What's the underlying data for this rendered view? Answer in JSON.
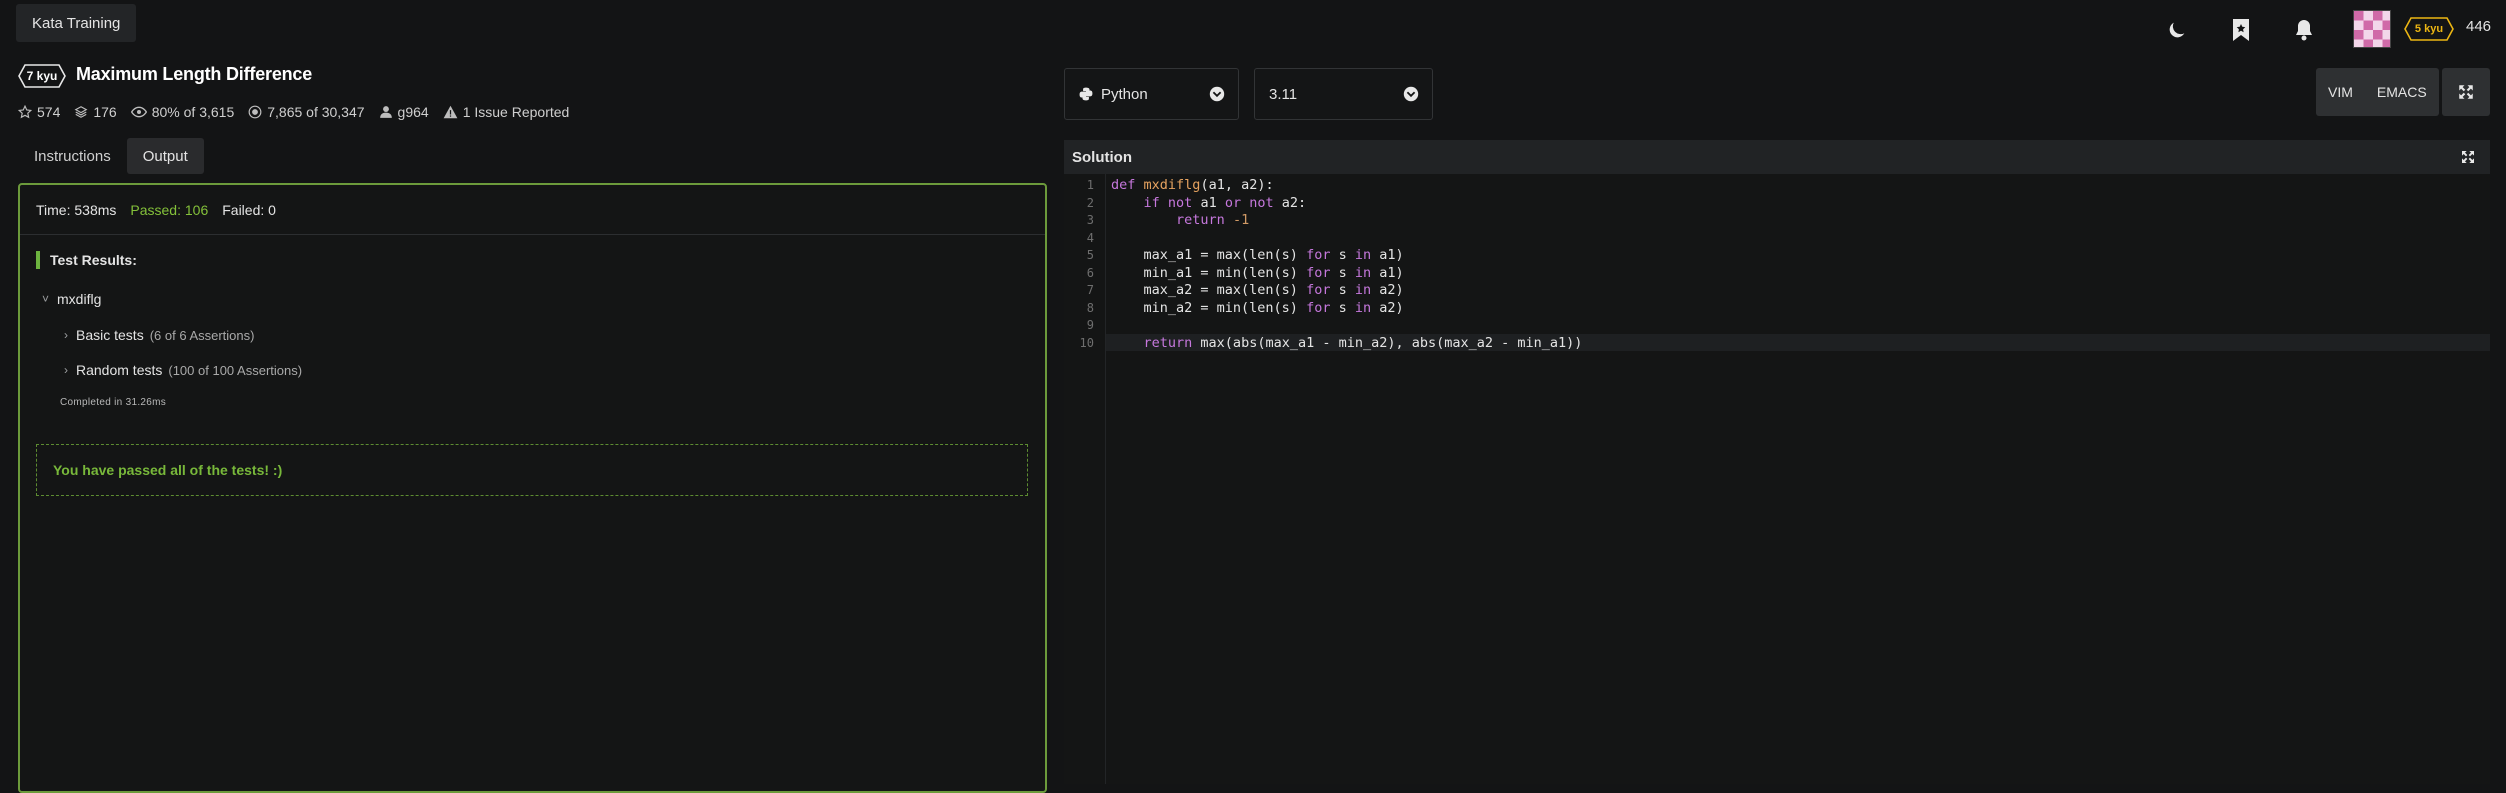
{
  "header": {
    "breadcrumb": "Kata Training",
    "icons": [
      "moon-icon",
      "bookmark-icon",
      "bell-icon"
    ],
    "user_rank": "5 kyu",
    "honor": "446"
  },
  "kata": {
    "rank": "7 kyu",
    "title": "Maximum Length Difference",
    "stats": {
      "stars": "574",
      "collections": "176",
      "satisfaction": "80% of 3,615",
      "completed": "7,865 of 30,347",
      "author": "g964",
      "issues": "1 Issue Reported"
    }
  },
  "tabs": [
    {
      "label": "Instructions",
      "active": false
    },
    {
      "label": "Output",
      "active": true
    }
  ],
  "output": {
    "time": "Time: 538ms",
    "passed": "Passed: 106",
    "failed": "Failed: 0",
    "results_title": "Test Results:",
    "suite_name": "mxdiflg",
    "subtests": [
      {
        "name": "Basic tests",
        "count": "(6 of 6 Assertions)"
      },
      {
        "name": "Random tests",
        "count": "(100 of 100 Assertions)"
      }
    ],
    "completed": "Completed in 31.26ms",
    "message": "You have passed all of the tests! :)"
  },
  "editor": {
    "language": "Python",
    "version": "3.11",
    "keymaps": [
      "VIM",
      "EMACS"
    ],
    "panel_title": "Solution",
    "line_numbers": [
      "1",
      "2",
      "3",
      "4",
      "5",
      "6",
      "7",
      "8",
      "9",
      "10"
    ]
  },
  "colors": {
    "background": "#131415",
    "accent_green": "#6db33f",
    "passed_green": "#84c13a",
    "rank_yellow": "#ecb613",
    "code_keyword": "#c678dd",
    "code_function": "#e6a360"
  }
}
